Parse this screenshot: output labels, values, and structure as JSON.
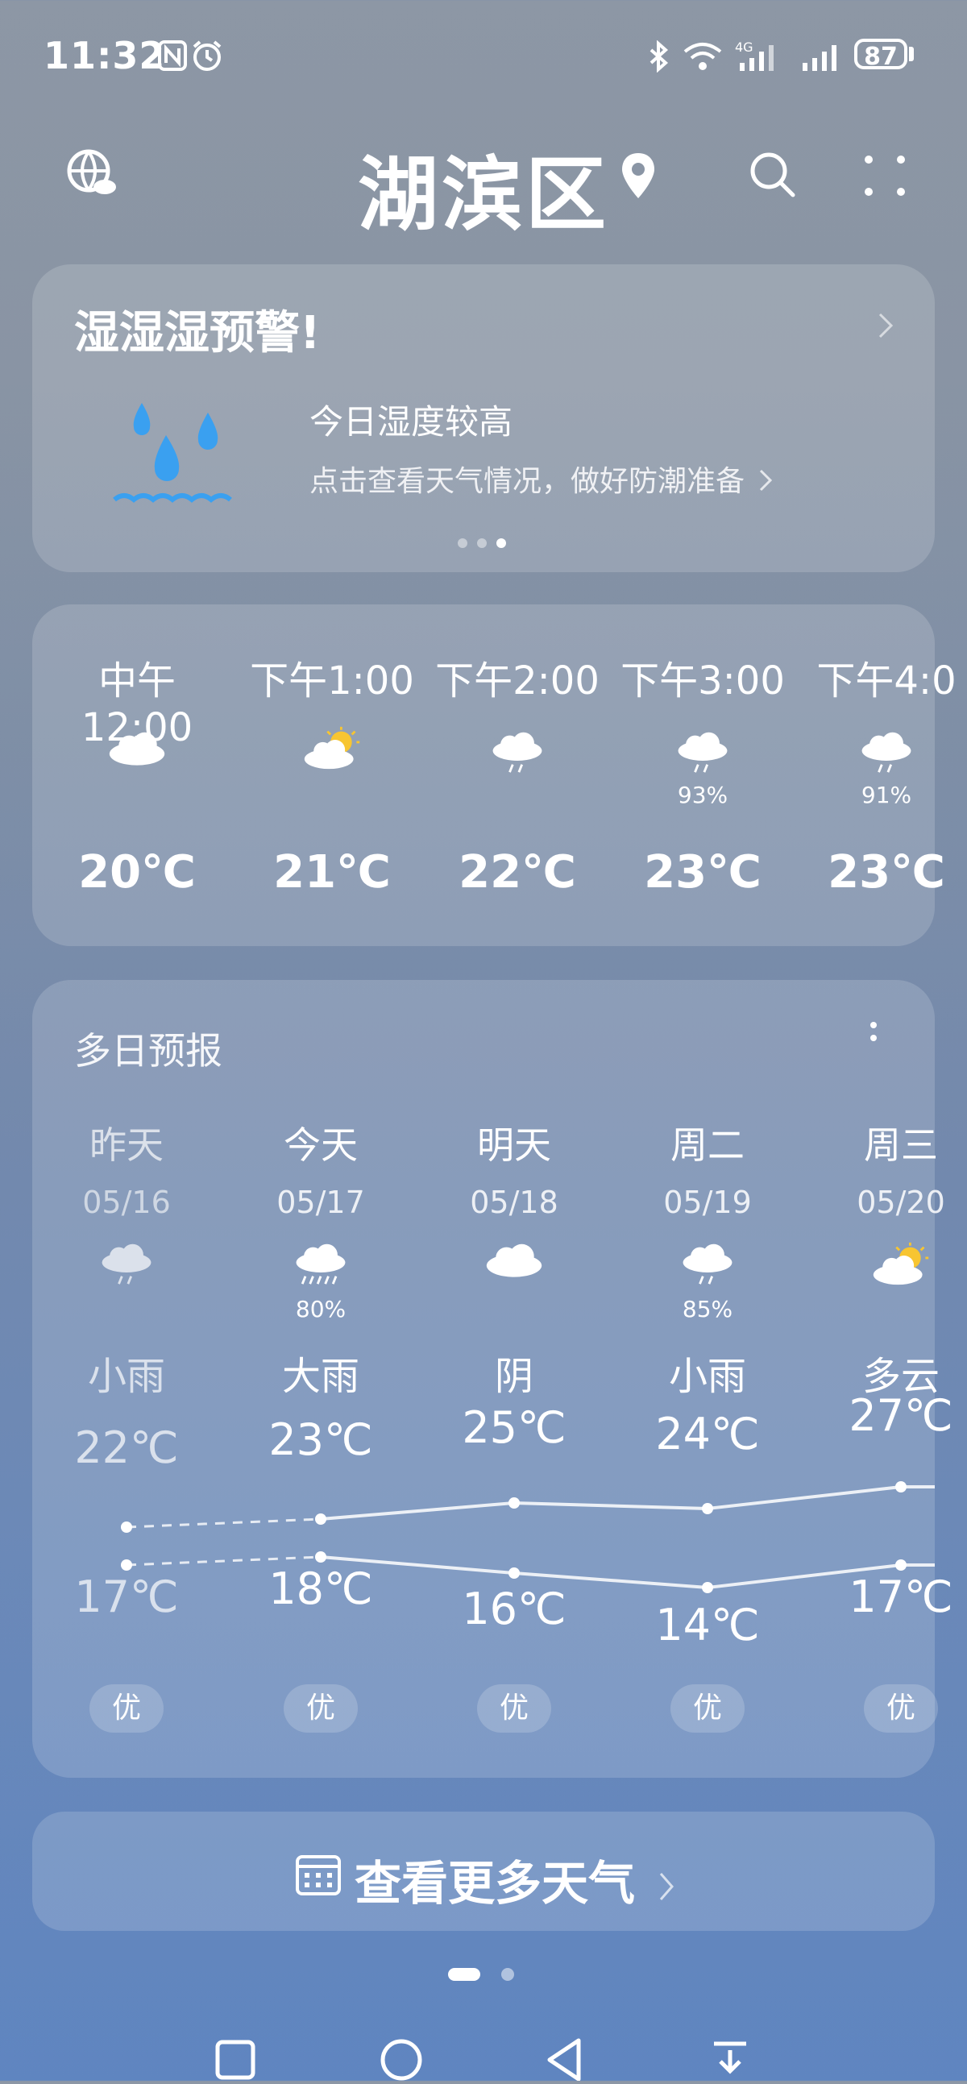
{
  "status_bar": {
    "time": "11:32",
    "battery": "87"
  },
  "header": {
    "city": "湖滨区"
  },
  "alert": {
    "title": "湿湿湿预警!",
    "main_text": "今日湿度较高",
    "sub_text": "点击查看天气情况，做好防潮准备"
  },
  "hourly": [
    {
      "time": "中午12:00",
      "icon": "cloud-icon",
      "pct": "",
      "temp": "20℃"
    },
    {
      "time": "下午1:00",
      "icon": "partly-cloudy-icon",
      "pct": "",
      "temp": "21℃"
    },
    {
      "time": "下午2:00",
      "icon": "rain-icon",
      "pct": "",
      "temp": "22℃"
    },
    {
      "time": "下午3:00",
      "icon": "rain-icon",
      "pct": "93%",
      "temp": "23℃"
    },
    {
      "time": "下午4:0",
      "icon": "rain-icon",
      "pct": "91%",
      "temp": "23℃"
    }
  ],
  "forecast": {
    "title": "多日预报",
    "days": [
      {
        "name": "昨天",
        "date": "05/16",
        "icon": "rain-icon",
        "pct": "",
        "cond": "小雨",
        "high": "22℃",
        "low": "17℃",
        "aqi": "优"
      },
      {
        "name": "今天",
        "date": "05/17",
        "icon": "heavy-rain-icon",
        "pct": "80%",
        "cond": "大雨",
        "high": "23℃",
        "low": "18℃",
        "aqi": "优"
      },
      {
        "name": "明天",
        "date": "05/18",
        "icon": "cloud-icon",
        "pct": "",
        "cond": "阴",
        "high": "25℃",
        "low": "16℃",
        "aqi": "优"
      },
      {
        "name": "周二",
        "date": "05/19",
        "icon": "rain-icon",
        "pct": "85%",
        "cond": "小雨",
        "high": "24℃",
        "low": "14℃",
        "aqi": "优"
      },
      {
        "name": "周三",
        "date": "05/20",
        "icon": "partly-cloudy-icon",
        "pct": "",
        "cond": "多云",
        "high": "27℃",
        "low": "17℃",
        "aqi": "优"
      }
    ]
  },
  "more_weather": {
    "label": "查看更多天气"
  },
  "colors": {
    "accent_sun": "#f7c531",
    "rain_drop": "#3aa0f0"
  }
}
